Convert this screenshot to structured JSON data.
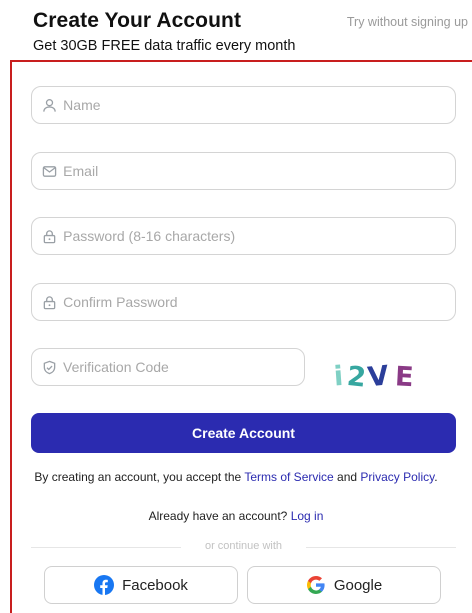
{
  "header": {
    "title": "Create Your Account",
    "subtitle": "Get 30GB FREE data traffic every month",
    "skip_link": "Try without signing up"
  },
  "form": {
    "name": {
      "placeholder": "Name",
      "icon": "user-icon"
    },
    "email": {
      "placeholder": "Email",
      "icon": "mail-icon"
    },
    "password": {
      "placeholder": "Password (8-16 characters)",
      "icon": "lock-icon"
    },
    "confirm_password": {
      "placeholder": "Confirm Password",
      "icon": "lock-icon"
    },
    "verification_code": {
      "placeholder": "Verification Code",
      "icon": "shield-check-icon"
    },
    "captcha_text": "i2VE",
    "submit_label": "Create Account"
  },
  "terms": {
    "prefix": "By creating an account, you accept the",
    "tos_link": "Terms of Service",
    "and": "and",
    "privacy_link": "Privacy Policy",
    "suffix": "."
  },
  "login": {
    "prompt": "Already have an account?",
    "link": "Log in"
  },
  "social": {
    "divider_text": "or continue with",
    "facebook_label": "Facebook",
    "google_label": "Google"
  },
  "colors": {
    "accent": "#2b2bb0",
    "panel_border": "#c81e1e",
    "facebook": "#1877f2"
  }
}
